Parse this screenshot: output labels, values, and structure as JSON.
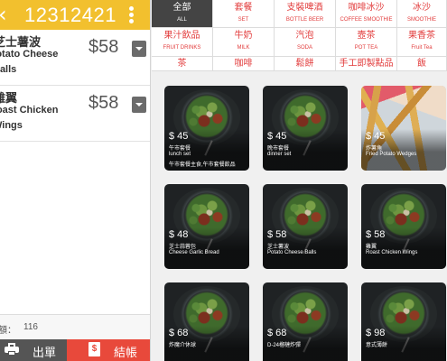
{
  "order": {
    "number": "12312421"
  },
  "cart": {
    "currency_items": [
      {
        "name_zh": "芝士薯波",
        "name_en_1": "Potato Cheese",
        "name_en_2": "Balls",
        "price": "$58"
      },
      {
        "name_zh": "雞翼",
        "name_en_1": "Roast Chicken",
        "name_en_2": "Wings",
        "price": "$58"
      }
    ],
    "total_label": "額：",
    "total_value": "116"
  },
  "actions": {
    "print_label": "出單",
    "checkout_label": "結帳",
    "bill_symbol": "$"
  },
  "categories": [
    {
      "zh": "全部",
      "en": "ALL",
      "active": true
    },
    {
      "zh": "套餐",
      "en": "SET"
    },
    {
      "zh": "支裝啤酒",
      "en": "BOTTLE BEER"
    },
    {
      "zh": "咖啡冰沙",
      "en": "COFFEE SMOOTHIE"
    },
    {
      "zh": "冰沙",
      "en": "SMOOTHIE"
    },
    {
      "zh": "果汁飲品",
      "en": "FRUIT DRINKS"
    },
    {
      "zh": "牛奶",
      "en": "MILK"
    },
    {
      "zh": "汽泡",
      "en": "SODA"
    },
    {
      "zh": "壼茶",
      "en": "POT TEA"
    },
    {
      "zh": "果香茶",
      "en": "Fruit Tea"
    },
    {
      "zh": "茶",
      "en": ""
    },
    {
      "zh": "咖啡",
      "en": ""
    },
    {
      "zh": "鬆餅",
      "en": ""
    },
    {
      "zh": "手工即製點品",
      "en": ""
    },
    {
      "zh": "飯",
      "en": ""
    }
  ],
  "products": [
    {
      "price": "$ 45",
      "l1": "午市套餐",
      "l2": "lunch set",
      "l3": "午市套餐主食,午市套餐飲品",
      "image": "salad"
    },
    {
      "price": "$ 45",
      "l1": "晚市套餐",
      "l2": "dinner set",
      "l3": "",
      "image": "salad"
    },
    {
      "price": "$ 45",
      "l1": "炸薯角",
      "l2": "Fried Potato Wedges",
      "l3": "",
      "image": "fries"
    },
    {
      "price": "$ 48",
      "l1": "芝士蒜蓉包",
      "l2": "Cheese Garlic Bread",
      "l3": "",
      "image": "salad"
    },
    {
      "price": "$ 58",
      "l1": "芝士薯波",
      "l2": "Potato Cheese Balls",
      "l3": "",
      "image": "salad"
    },
    {
      "price": "$ 58",
      "l1": "雞翼",
      "l2": "Roast Chicken Wings",
      "l3": "",
      "image": "salad"
    },
    {
      "price": "$ 68",
      "l1": "炸魔介休球",
      "l2": "",
      "l3": "",
      "image": "salad"
    },
    {
      "price": "$ 68",
      "l1": "D-24榴槤炸彈",
      "l2": "",
      "l3": "",
      "image": "salad"
    },
    {
      "price": "$ 98",
      "l1": "意式薄餅",
      "l2": "",
      "l3": "",
      "image": "salad"
    }
  ]
}
